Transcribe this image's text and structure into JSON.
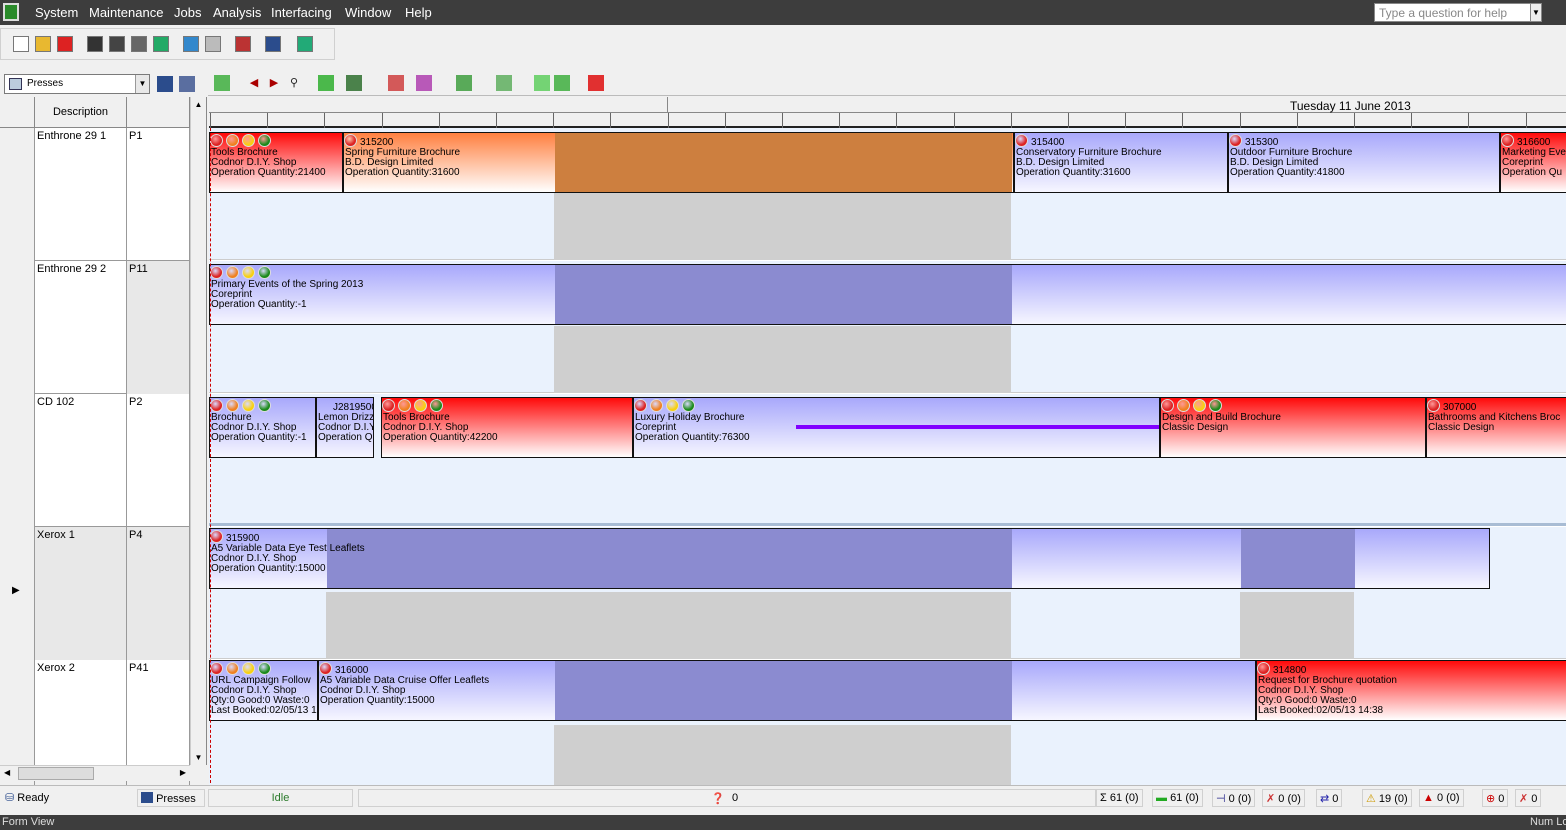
{
  "menu": {
    "items": [
      "System",
      "Maintenance",
      "Jobs",
      "Analysis",
      "Interfacing",
      "Window",
      "Help"
    ],
    "help_placeholder": "Type a question for help"
  },
  "icons_toolbar1": [
    "new-icon",
    "open-icon",
    "delete-icon",
    "save-icon",
    "save-all-icon",
    "properties-icon",
    "schedule-icon",
    "move-icon",
    "refresh-icon",
    "report-icon",
    "calendar-icon",
    "export-icon"
  ],
  "icons_toolbar2": [
    "map-icon",
    "previous-icon",
    "next-icon",
    "find-icon",
    "recycle-icon",
    "split-icon",
    "query-icon",
    "sort-icon",
    "columns-icon",
    "filter-icon",
    "expand-icon",
    "collapse-icon",
    "pin-icon"
  ],
  "view_selector": {
    "value": "Presses"
  },
  "grid": {
    "header": "Description",
    "rows": [
      {
        "name": "Enthrone 29 1",
        "code": "P1"
      },
      {
        "name": "Enthrone 29 2",
        "code": "P11"
      },
      {
        "name": "CD 102",
        "code": "P2"
      },
      {
        "name": "Xerox 1",
        "code": "P4",
        "current": true
      },
      {
        "name": "Xerox 2",
        "code": "P41"
      }
    ]
  },
  "timeline": {
    "date": "Tuesday 11 June 2013"
  },
  "colors": {
    "red": "#ff0a0a",
    "blue": "#a8a8fb",
    "orange": "#ff8040",
    "nonworking": "#cfcfcf",
    "progress": "#8000ff"
  },
  "tasks": [
    {
      "row": 0,
      "color": "red",
      "lights": 4,
      "lines": [
        "",
        "Tools Brochure",
        "Codnor D.I.Y. Shop",
        "Operation Quantity:21400"
      ]
    },
    {
      "row": 0,
      "color": "orange",
      "lights": 1,
      "lines": [
        "315200",
        "Spring Furniture Brochure",
        "B.D. Design Limited",
        "Operation Quantity:31600"
      ]
    },
    {
      "row": 0,
      "color": "blue",
      "lights": 1,
      "lines": [
        "315400",
        "Conservatory Furniture Brochure",
        "B.D. Design Limited",
        "Operation Quantity:31600"
      ]
    },
    {
      "row": 0,
      "color": "blue",
      "lights": 1,
      "lines": [
        "315300",
        "Outdoor Furniture Brochure",
        "B.D. Design Limited",
        "Operation Quantity:41800"
      ]
    },
    {
      "row": 0,
      "color": "red",
      "lights": 1,
      "lines": [
        "316600",
        "Marketing Eve",
        "Coreprint",
        "Operation Qu"
      ]
    },
    {
      "row": 1,
      "color": "blue",
      "lights": 4,
      "lines": [
        "",
        "Primary Events of the Spring 2013",
        "Coreprint",
        "Operation Quantity:-1"
      ]
    },
    {
      "row": 2,
      "color": "blue",
      "lights": 4,
      "lines": [
        "",
        "Brochure",
        "Codnor D.I.Y. Shop",
        "Operation Quantity:-1"
      ]
    },
    {
      "row": 2,
      "color": "blue",
      "lights": 0,
      "lines": [
        "J2819500",
        "Lemon Drizz",
        "Codnor D.I.Y",
        "Operation Q"
      ]
    },
    {
      "row": 2,
      "color": "red",
      "lights": 4,
      "lines": [
        "",
        "Tools Brochure",
        "Codnor D.I.Y. Shop",
        "Operation Quantity:42200"
      ]
    },
    {
      "row": 2,
      "color": "blue",
      "lights": 4,
      "lines": [
        "",
        "Luxury Holiday Brochure",
        "Coreprint",
        "Operation Quantity:76300"
      ]
    },
    {
      "row": 2,
      "color": "red",
      "lights": 4,
      "lines": [
        "",
        "Design and Build Brochure",
        "Classic Design"
      ]
    },
    {
      "row": 2,
      "color": "red",
      "lights": 1,
      "lines": [
        "307000",
        "Bathrooms and Kitchens Broc",
        "Classic Design"
      ]
    },
    {
      "row": 3,
      "color": "blue",
      "lights": 1,
      "lines": [
        "315900",
        "A5 Variable Data Eye Test Leaflets",
        "Codnor D.I.Y. Shop",
        "Operation Quantity:15000"
      ]
    },
    {
      "row": 4,
      "color": "blue",
      "lights": 4,
      "lines": [
        "",
        "URL Campaign Follow",
        "Codnor D.I.Y. Shop",
        "Qty:0 Good:0 Waste:0",
        "Last Booked:02/05/13 1"
      ]
    },
    {
      "row": 4,
      "color": "blue",
      "lights": 1,
      "lines": [
        "316000",
        "A5 Variable Data Cruise Offer Leaflets",
        "Codnor D.I.Y. Shop",
        "Operation Quantity:15000"
      ]
    },
    {
      "row": 4,
      "color": "red",
      "lights": 1,
      "lines": [
        "314800",
        "Request for Brochure quotation",
        "Codnor D.I.Y. Shop",
        "Qty:0 Good:0 Waste:0",
        "Last Booked:02/05/13 14:38"
      ]
    }
  ],
  "status": {
    "ready": "Ready",
    "view": "Presses",
    "state": "Idle",
    "query_count": "0",
    "counters": [
      {
        "icon": "sigma-icon",
        "glyph": "Σ",
        "text": "61 (0)"
      },
      {
        "icon": "scheduled-icon",
        "glyph": "▬",
        "text": "61 (0)"
      },
      {
        "icon": "deadline-icon",
        "glyph": "⊣",
        "text": "0 (0)"
      },
      {
        "icon": "unscheduled-icon",
        "glyph": "✗",
        "text": "0 (0)"
      },
      {
        "icon": "transfer-icon",
        "glyph": "⇄",
        "text": "0"
      },
      {
        "icon": "warning-icon",
        "glyph": "⚠",
        "text": "19 (0)"
      },
      {
        "icon": "error-icon",
        "glyph": "▲",
        "text": "0 (0)"
      },
      {
        "icon": "conflict-icon",
        "glyph": "⊕",
        "text": "0"
      },
      {
        "icon": "cancelled-icon",
        "glyph": "✗",
        "text": "0"
      }
    ]
  },
  "footer": {
    "left": "Form View",
    "right": "Num Lock"
  }
}
